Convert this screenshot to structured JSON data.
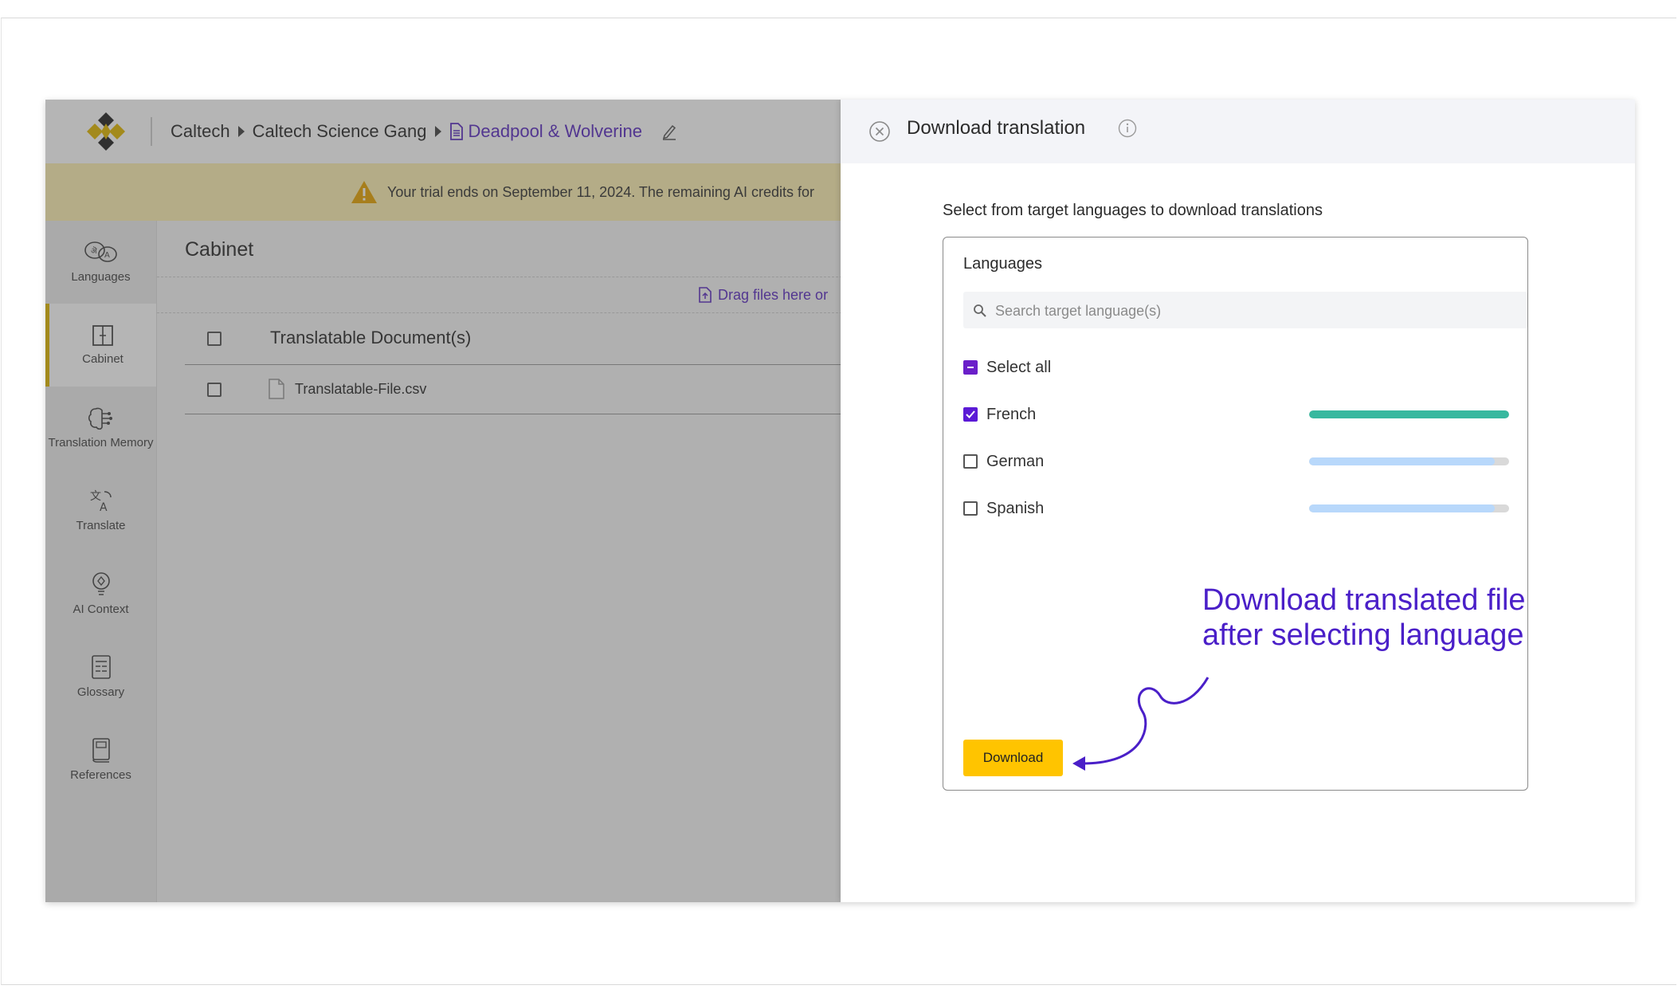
{
  "breadcrumb": {
    "org": "Caltech",
    "team": "Caltech Science Gang",
    "document": "Deadpool & Wolverine"
  },
  "trial_banner": {
    "text": "Your trial ends on September 11, 2024. The remaining AI credits for"
  },
  "sidebar": {
    "items": [
      {
        "label": "Languages",
        "icon": "languages-icon"
      },
      {
        "label": "Cabinet",
        "icon": "cabinet-icon"
      },
      {
        "label": "Translation Memory",
        "icon": "brain-icon"
      },
      {
        "label": "Translate",
        "icon": "translate-icon"
      },
      {
        "label": "AI Context",
        "icon": "bulb-icon"
      },
      {
        "label": "Glossary",
        "icon": "glossary-icon"
      },
      {
        "label": "References",
        "icon": "book-icon"
      }
    ],
    "active": "Cabinet"
  },
  "cabinet": {
    "title": "Cabinet",
    "dropzone_text": "Drag files here or",
    "table_header": "Translatable Document(s)",
    "rows": [
      {
        "name": "Translatable-File.csv"
      }
    ]
  },
  "panel": {
    "title": "Download translation",
    "instruction": "Select from target languages to download translations",
    "languages_title": "Languages",
    "search_placeholder": "Search target language(s)",
    "select_all_label": "Select all",
    "languages": [
      {
        "name": "French",
        "checked": true,
        "progress": 1.0,
        "color": "#38b89f"
      },
      {
        "name": "German",
        "checked": false,
        "progress": 0.93,
        "color": "#b8d8fb"
      },
      {
        "name": "Spanish",
        "checked": false,
        "progress": 0.93,
        "color": "#b8d8fb"
      }
    ],
    "annotation_line1": "Download translated file",
    "annotation_line2": "after selecting language",
    "download_label": "Download"
  },
  "colors": {
    "accent_purple": "#5b2cc2",
    "annotation_purple": "#4a1fc8",
    "download_yellow": "#ffc400",
    "trial_yellow": "#fdf1b3",
    "active_marker": "#e2b800"
  }
}
